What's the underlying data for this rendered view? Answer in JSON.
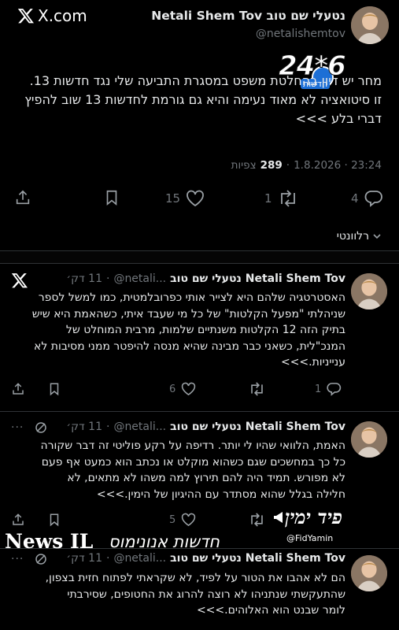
{
  "header": {
    "site_label": "X.com",
    "author_name": "Netali Shem Tov נטעלי שם טוב",
    "author_handle": "@netalishemtov"
  },
  "main_tweet": {
    "text_line1": "מחר יש דיון בהחלטת משפט במסגרת התביעה שלי נגד חדשות 13.",
    "text_line2": "זו סיטואציה לא מאוד נעימה והיא גם גורמת לחדשות 13 שוב להפיץ",
    "text_line3": "דברי בלע >>>",
    "timestamp": "1.8.2026 · 23:24",
    "views_count": "289",
    "views_label": "צפיות",
    "reply_count": "4",
    "retweet_count": "1",
    "like_count": "15",
    "relevant_label": "רלוונטי"
  },
  "thread": [
    {
      "name": "Netali Shem Tov נטעלי שם טוב",
      "handle": "@netali...",
      "time": "11 דק׳",
      "lines": [
        "האסטרטגיה שלהם היא לצייר אותי כפרובלמטית, כמו למשל לספר",
        "שניהלתי \"מפעל הקלטות\" של כל מי שעבד איתי, כשהאמת היא שיש",
        "בתיק הזה 12 הקלטות משנתיים שלמות, מרבית המוחלט של",
        "המנכ\"לית, כשאני כבר מבינה שהיא מנסה להיפטר ממני מסיבות לא",
        "ענייניות.>>>"
      ],
      "reply_count": "1",
      "retweet_count": "",
      "like_count": "6"
    },
    {
      "name": "Netali Shem Tov נטעלי שם טוב",
      "handle": "@netali...",
      "time": "11 דק׳",
      "lines": [
        "האמת, הלוואי שהיו לי יותר. רדיפה על רקע פוליטי זה דבר שקורה",
        "כל כך במחשכים שגם כשהוא מוקלט או נכתב הוא כמעט אף פעם",
        "לא מפורש. תמיד היה להם תירוץ למה משהו לא מתאים, לא",
        "חלילה בגלל שהוא מסתדר עם ההיגיון של הימין.>>>"
      ],
      "reply_count": "",
      "retweet_count": "",
      "like_count": "5"
    },
    {
      "name": "Netali Shem Tov נטעלי שם טוב",
      "handle": "@netali...",
      "time": "11 דק׳",
      "lines": [
        "הם לא אהבו את הטור על לפיד, לא שקראתי לפתוח חזית בצפון,",
        "שהתעקשתי שנתניהו לא רוצה להרוג את החטופים, שסירבתי",
        "לומר שבנט הוא האלוהים.>>>"
      ]
    }
  ],
  "watermarks": {
    "logo_2406": "24*6",
    "logo_2406_sub": "חדשות",
    "fidyamin_script": "פיד ימין",
    "fidyamin_handle": "@FidYamin",
    "newsil_latin": "News IL",
    "newsil_hebrew": "חדשות אנונימוס"
  },
  "colors": {
    "background": "#000000",
    "text": "#e7e9ea",
    "muted": "#71767b",
    "divider": "#2f3336"
  }
}
